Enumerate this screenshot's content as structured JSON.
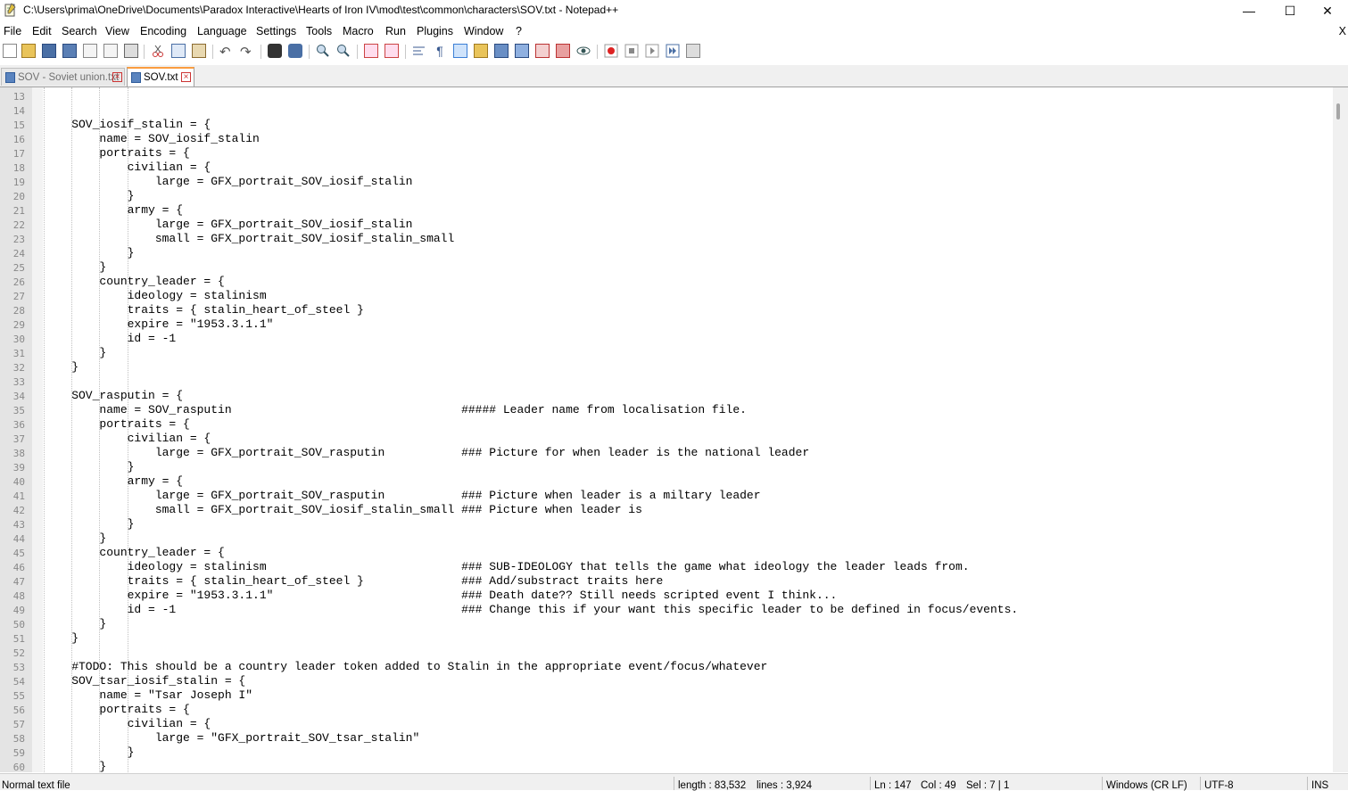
{
  "window": {
    "title": "C:\\Users\\prima\\OneDrive\\Documents\\Paradox Interactive\\Hearts of Iron IV\\mod\\test\\common\\characters\\SOV.txt - Notepad++",
    "minimize": "—",
    "maximize": "☐",
    "close": "✕"
  },
  "menu": {
    "items": [
      "File",
      "Edit",
      "Search",
      "View",
      "Encoding",
      "Language",
      "Settings",
      "Tools",
      "Macro",
      "Run",
      "Plugins",
      "Window",
      "?"
    ],
    "close_doc": "X"
  },
  "tabs": [
    {
      "label": "SOV - Soviet union.txt",
      "active": false
    },
    {
      "label": "SOV.txt",
      "active": true
    }
  ],
  "editor": {
    "first_line_number": 13,
    "lines": [
      "",
      "",
      "    SOV_iosif_stalin = {",
      "        name = SOV_iosif_stalin",
      "        portraits = {",
      "            civilian = {",
      "                large = GFX_portrait_SOV_iosif_stalin",
      "            }",
      "            army = {",
      "                large = GFX_portrait_SOV_iosif_stalin",
      "                small = GFX_portrait_SOV_iosif_stalin_small",
      "            }",
      "        }",
      "        country_leader = {",
      "            ideology = stalinism",
      "            traits = { stalin_heart_of_steel }",
      "            expire = \"1953.3.1.1\"",
      "            id = -1",
      "        }",
      "    }",
      "",
      "    SOV_rasputin = {",
      "        name = SOV_rasputin                                 ##### Leader name from localisation file.",
      "        portraits = {",
      "            civilian = {",
      "                large = GFX_portrait_SOV_rasputin           ### Picture for when leader is the national leader",
      "            }",
      "            army = {",
      "                large = GFX_portrait_SOV_rasputin           ### Picture when leader is a miltary leader",
      "                small = GFX_portrait_SOV_iosif_stalin_small ### Picture when leader is",
      "            }",
      "        }",
      "        country_leader = {",
      "            ideology = stalinism                            ### SUB-IDEOLOGY that tells the game what ideology the leader leads from.",
      "            traits = { stalin_heart_of_steel }              ### Add/substract traits here",
      "            expire = \"1953.3.1.1\"                           ### Death date?? Still needs scripted event I think...",
      "            id = -1                                         ### Change this if your want this specific leader to be defined in focus/events.",
      "        }",
      "    }",
      "",
      "    #TODO: This should be a country leader token added to Stalin in the appropriate event/focus/whatever",
      "    SOV_tsar_iosif_stalin = {",
      "        name = \"Tsar Joseph I\"",
      "        portraits = {",
      "            civilian = {",
      "                large = \"GFX_portrait_SOV_tsar_stalin\"",
      "            }",
      "        }"
    ]
  },
  "status": {
    "file_type": "Normal text file",
    "length": "length : 83,532",
    "lines": "lines : 3,924",
    "ln": "Ln : 147",
    "col": "Col : 49",
    "sel": "Sel : 7 | 1",
    "eol": "Windows (CR LF)",
    "encoding": "UTF-8",
    "mode": "INS"
  }
}
